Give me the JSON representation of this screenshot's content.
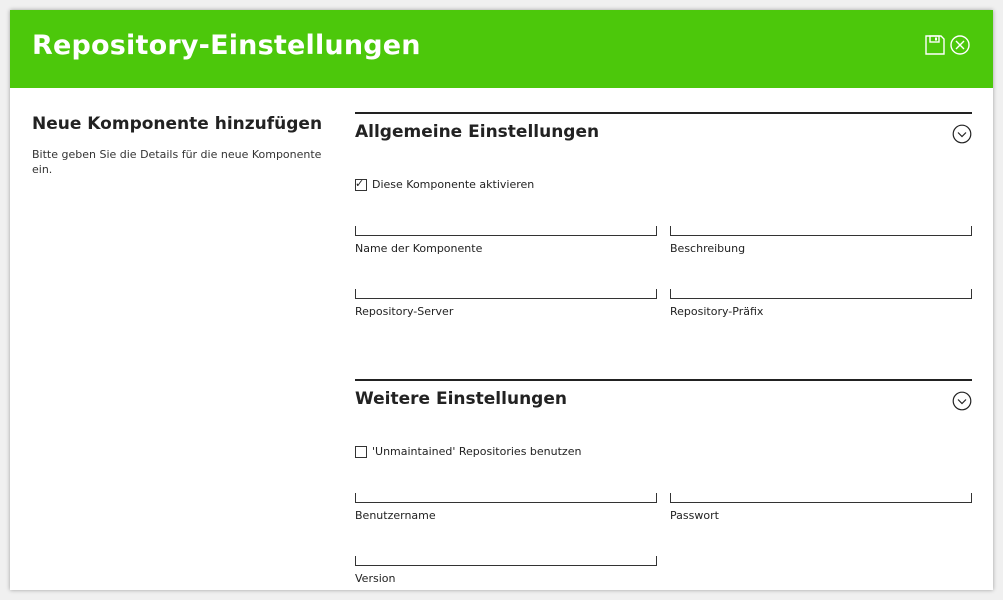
{
  "header": {
    "title": "Repository-Einstellungen",
    "save_icon": "save-icon",
    "close_icon": "close-circle-icon",
    "color": "#4cc80b"
  },
  "left": {
    "title": "Neue Komponente hinzufügen",
    "description": "Bitte geben Sie die Details für die neue Komponente ein."
  },
  "sections": [
    {
      "title": "Allgemeine Einstellungen",
      "checkbox": {
        "label": "Diese Komponente aktivieren",
        "checked": true
      },
      "fields": [
        {
          "label": "Name der Komponente",
          "value": ""
        },
        {
          "label": "Beschreibung",
          "value": ""
        },
        {
          "label": "Repository-Server",
          "value": ""
        },
        {
          "label": "Repository-Präfix",
          "value": ""
        }
      ]
    },
    {
      "title": "Weitere Einstellungen",
      "checkbox": {
        "label": "'Unmaintained' Repositories benutzen",
        "checked": false
      },
      "fields": [
        {
          "label": "Benutzername",
          "value": ""
        },
        {
          "label": "Passwort",
          "value": ""
        },
        {
          "label": "Version",
          "value": ""
        }
      ]
    }
  ]
}
